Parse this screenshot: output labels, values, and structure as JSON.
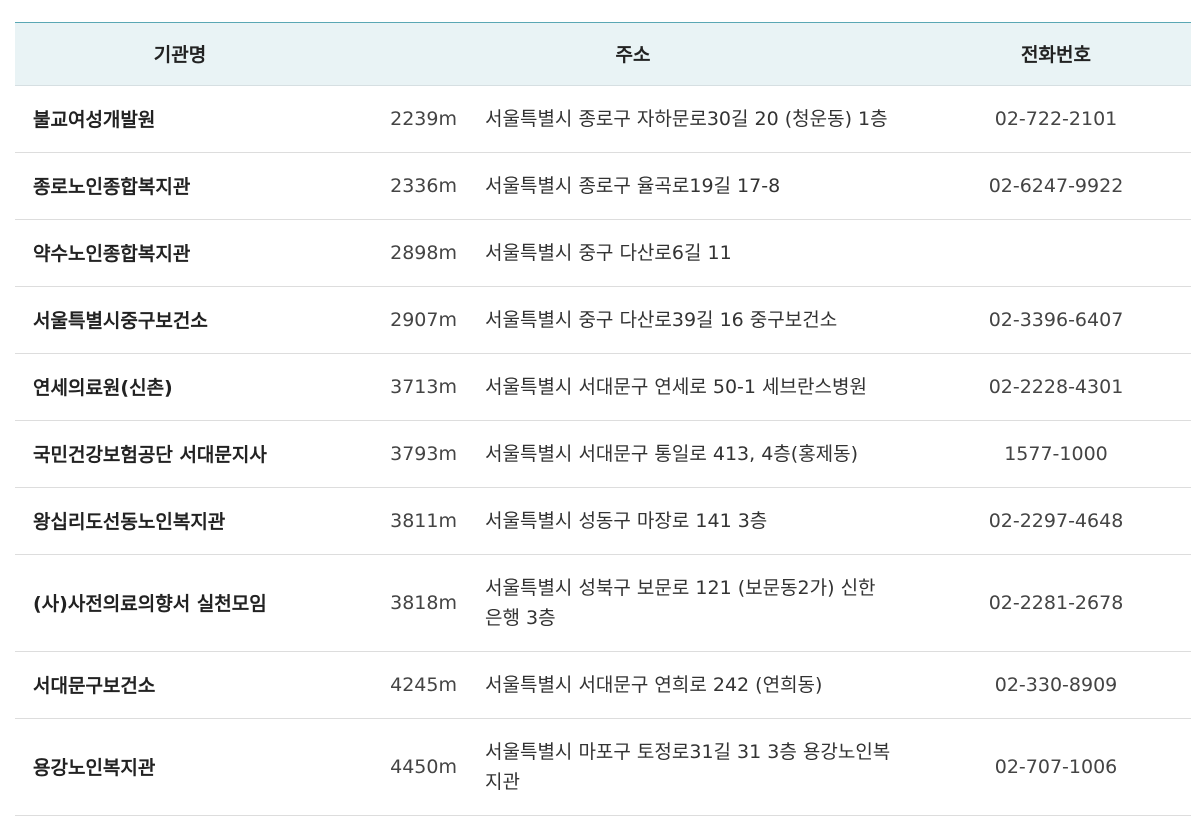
{
  "table": {
    "headers": {
      "name": "기관명",
      "address": "주소",
      "phone": "전화번호"
    },
    "rows": [
      {
        "name": "불교여성개발원",
        "distance": "2239m",
        "address": "서울특별시 종로구 자하문로30길 20 (청운동) 1층",
        "phone": "02-722-2101"
      },
      {
        "name": "종로노인종합복지관",
        "distance": "2336m",
        "address": "서울특별시 종로구 율곡로19길 17-8",
        "phone": "02-6247-9922"
      },
      {
        "name": "약수노인종합복지관",
        "distance": "2898m",
        "address": "서울특별시 중구 다산로6길 11",
        "phone": ""
      },
      {
        "name": "서울특별시중구보건소",
        "distance": "2907m",
        "address": "서울특별시 중구 다산로39길 16 중구보건소",
        "phone": "02-3396-6407"
      },
      {
        "name": "연세의료원(신촌)",
        "distance": "3713m",
        "address": "서울특별시 서대문구 연세로 50-1 세브란스병원",
        "phone": "02-2228-4301"
      },
      {
        "name": "국민건강보험공단 서대문지사",
        "distance": "3793m",
        "address": "서울특별시 서대문구 통일로 413, 4층(홍제동)",
        "phone": "1577-1000"
      },
      {
        "name": "왕십리도선동노인복지관",
        "distance": "3811m",
        "address": "서울특별시 성동구 마장로 141 3층",
        "phone": "02-2297-4648"
      },
      {
        "name": "(사)사전의료의향서 실천모임",
        "distance": "3818m",
        "address": "서울특별시 성북구 보문로 121 (보문동2가) 신한은행 3층",
        "phone": "02-2281-2678"
      },
      {
        "name": "서대문구보건소",
        "distance": "4245m",
        "address": "서울특별시 서대문구 연희로 242 (연희동)",
        "phone": "02-330-8909"
      },
      {
        "name": "용강노인복지관",
        "distance": "4450m",
        "address": "서울특별시 마포구 토정로31길 31 3층 용강노인복지관",
        "phone": "02-707-1006"
      }
    ]
  }
}
